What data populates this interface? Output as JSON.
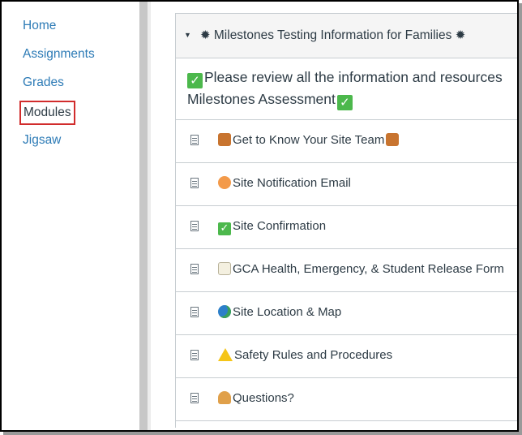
{
  "nav": {
    "home": "Home",
    "assignments": "Assignments",
    "grades": "Grades",
    "modules": "Modules",
    "jigsaw": "Jigsaw"
  },
  "module": {
    "title": "Milestones Testing Information for Families",
    "title_icon": "sparkle-badge-icon",
    "intro_line1": "Please review all the information and resources",
    "intro_line2": "Milestones Assessment",
    "items": [
      {
        "label": "Get to Know Your Site Team",
        "icon": "people-icon"
      },
      {
        "label": "Site Notification Email",
        "icon": "peach-icon"
      },
      {
        "label": "Site Confirmation",
        "icon": "check-icon"
      },
      {
        "label": "GCA Health, Emergency, & Student Release Form",
        "icon": "memo-icon"
      },
      {
        "label": "Site Location & Map",
        "icon": "globe-icon"
      },
      {
        "label": "Safety Rules and Procedures",
        "icon": "warning-icon"
      },
      {
        "label": "Questions?",
        "icon": "raising-hand-icon"
      }
    ]
  },
  "colors": {
    "link": "#2d7bb6",
    "text": "#2d3b45",
    "active_outline": "#d12c2c",
    "check_green": "#4cb84c",
    "border": "#c7cdd1"
  }
}
